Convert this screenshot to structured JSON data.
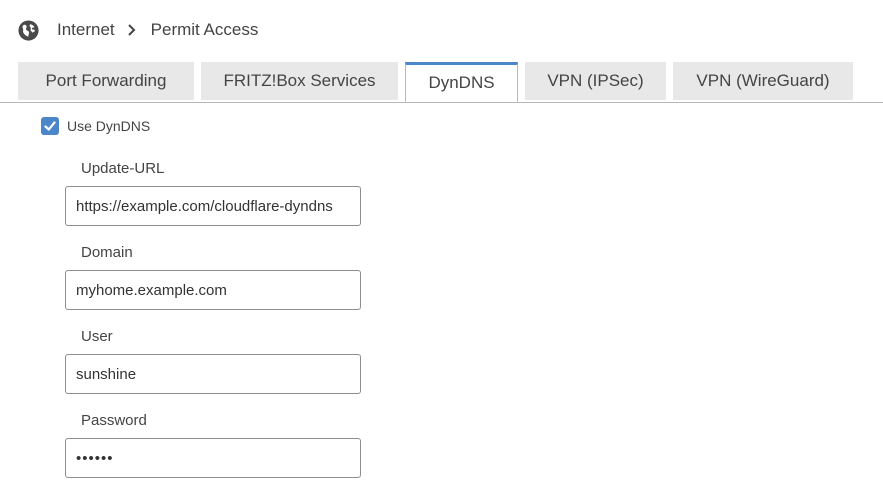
{
  "breadcrumb": {
    "icon": "globe-icon",
    "items": [
      "Internet",
      "Permit Access"
    ]
  },
  "tabs": [
    {
      "label": "Port Forwarding",
      "active": false
    },
    {
      "label": "FRITZ!Box Services",
      "active": false
    },
    {
      "label": "DynDNS",
      "active": true
    },
    {
      "label": "VPN (IPSec)",
      "active": false
    },
    {
      "label": "VPN (WireGuard)",
      "active": false
    }
  ],
  "use_dyndns": {
    "label": "Use DynDNS",
    "checked": true
  },
  "fields": {
    "update_url": {
      "label": "Update-URL",
      "value": "https://example.com/cloudflare-dyndns"
    },
    "domain": {
      "label": "Domain",
      "value": "myhome.example.com"
    },
    "user": {
      "label": "User",
      "value": "sunshine"
    },
    "password": {
      "label": "Password",
      "value": "••••••"
    }
  },
  "colors": {
    "accent": "#4a86c8",
    "tab_inactive_bg": "#e8e8e8",
    "text": "#444444"
  }
}
